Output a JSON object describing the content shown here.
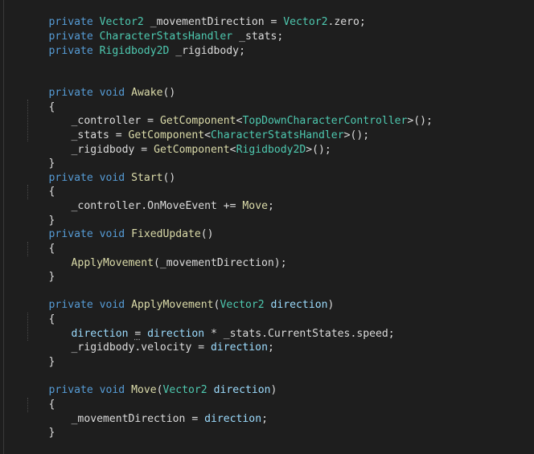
{
  "editor": {
    "language": "C#",
    "colors": {
      "background": "#1e1e1e",
      "keyword": "#569cd6",
      "type": "#4ec9b0",
      "method": "#dcdcaa",
      "identifier": "#dcdcdc",
      "parameter": "#9cdcfe"
    }
  },
  "code": {
    "l01": {
      "t1": "private",
      "t2": "Vector2",
      "t3": "_movementDirection",
      "t4": "=",
      "t5": "Vector2",
      "t6": ".zero;"
    },
    "l02": {
      "t1": "private",
      "t2": "CharacterStatsHandler",
      "t3": "_stats;"
    },
    "l03": {
      "t1": "private",
      "t2": "Rigidbody2D",
      "t3": "_rigidbody;"
    },
    "l04": {
      "t1": "private",
      "t2": "void",
      "t3": "Awake",
      "t4": "()"
    },
    "l05": {
      "t1": "{"
    },
    "l06": {
      "t1": "_controller",
      "t2": "=",
      "t3": "GetComponent",
      "t4": "<",
      "t5": "TopDownCharacterController",
      "t6": ">();"
    },
    "l07": {
      "t1": "_stats",
      "t2": "=",
      "t3": "GetComponent",
      "t4": "<",
      "t5": "CharacterStatsHandler",
      "t6": ">();"
    },
    "l08": {
      "t1": "_rigidbody",
      "t2": "=",
      "t3": "GetComponent",
      "t4": "<",
      "t5": "Rigidbody2D",
      "t6": ">();"
    },
    "l09": {
      "t1": "}"
    },
    "l10": {
      "t1": "private",
      "t2": "void",
      "t3": "Start",
      "t4": "()"
    },
    "l11": {
      "t1": "{"
    },
    "l12": {
      "t1": "_controller.OnMoveEvent",
      "t2": "+=",
      "t3": "Move",
      "t4": ";"
    },
    "l13": {
      "t1": "}"
    },
    "l14": {
      "t1": "private",
      "t2": "void",
      "t3": "FixedUpdate",
      "t4": "()"
    },
    "l15": {
      "t1": "{"
    },
    "l16": {
      "t1": "ApplyMovement",
      "t2": "(_movementDirection);"
    },
    "l17": {
      "t1": "}"
    },
    "l18": {
      "t1": "private",
      "t2": "void",
      "t3": "ApplyMovement",
      "t4": "(",
      "t5": "Vector2",
      "t6": "direction",
      "t7": ")"
    },
    "l19": {
      "t1": "{"
    },
    "l20": {
      "t1": "direction",
      "t2": "=",
      "t3": "direction",
      "t4": "* _stats.CurrentStates.speed;"
    },
    "l21": {
      "t1": "_rigidbody.velocity",
      "t2": "=",
      "t3": "direction",
      "t4": ";"
    },
    "l22": {
      "t1": "}"
    },
    "l23": {
      "t1": "private",
      "t2": "void",
      "t3": "Move",
      "t4": "(",
      "t5": "Vector2",
      "t6": "direction",
      "t7": ")"
    },
    "l24": {
      "t1": "{"
    },
    "l25": {
      "t1": "_movementDirection",
      "t2": "=",
      "t3": "direction",
      "t4": ";"
    },
    "l26": {
      "t1": "}"
    }
  }
}
